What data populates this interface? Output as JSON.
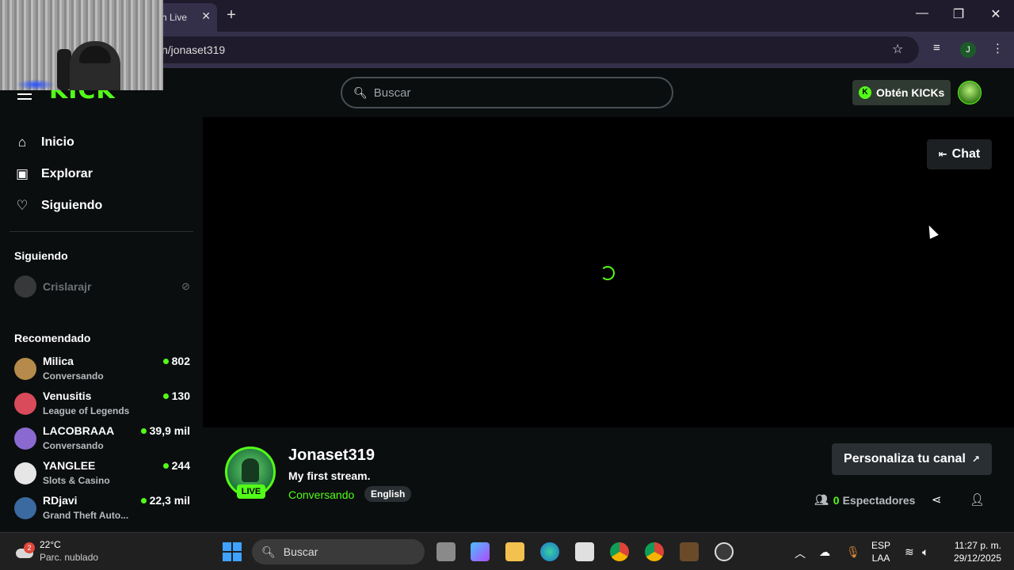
{
  "browser": {
    "tab_title": "ch Live",
    "address": "n/jonaset319",
    "profile_initial": "J"
  },
  "header": {
    "logo": "KICK",
    "search_placeholder": "Buscar",
    "kicks_button": "Obtén KICKs"
  },
  "sidebar": {
    "nav": [
      {
        "label": "Inicio",
        "icon": "home-icon"
      },
      {
        "label": "Explorar",
        "icon": "browse-icon"
      },
      {
        "label": "Siguiendo",
        "icon": "heart-icon"
      }
    ],
    "following_title": "Siguiendo",
    "following": [
      {
        "name": "Crislarajr"
      }
    ],
    "recommended_title": "Recomendado",
    "recommended": [
      {
        "name": "Milica",
        "category": "Conversando",
        "viewers": "802",
        "color": "#b58a4a"
      },
      {
        "name": "Venusitis",
        "category": "League of Legends",
        "viewers": "130",
        "color": "#d94a5a"
      },
      {
        "name": "LACOBRAAA",
        "category": "Conversando",
        "viewers": "39,9 mil",
        "color": "#8a6ad0"
      },
      {
        "name": "YANGLEE",
        "category": "Slots & Casino",
        "viewers": "244",
        "color": "#e6e6e6"
      },
      {
        "name": "RDjavi",
        "category": "Grand Theft Auto...",
        "viewers": "22,3 mil",
        "color": "#3a6aa0"
      }
    ]
  },
  "player": {
    "chat_label": "Chat"
  },
  "channel": {
    "name": "Jonaset319",
    "live_label": "LIVE",
    "stream_title": "My first stream.",
    "category": "Conversando",
    "language": "English",
    "customize_label": "Personaliza tu canal",
    "viewers_count": "0",
    "viewers_label": "Espectadores"
  },
  "taskbar": {
    "weather_badge": "2",
    "temperature": "22°C",
    "condition": "Parc. nublado",
    "search_label": "Buscar",
    "lang_top": "ESP",
    "lang_bottom": "LAA",
    "time": "11:27 p. m.",
    "date": "29/12/2025"
  },
  "colors": {
    "accent": "#53fc18",
    "background": "#0b0e0f"
  }
}
